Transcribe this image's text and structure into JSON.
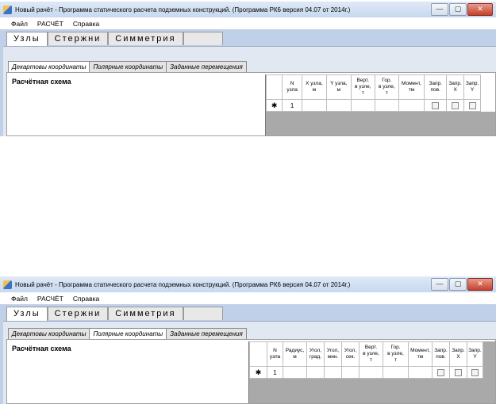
{
  "window": {
    "title_top": "Новый рачёт  -  Программа статического расчета подземных конструкций.  (Программа РК6 версия 04.07 от 2014г.)",
    "title_bottom": "Новый рачёт  -  Программа статического расчета подземных конструкций.  (Программа РК6 версия 04.07 от 2014г.)",
    "minimize": "—",
    "maximize": "▢",
    "close": "✕"
  },
  "menu": [
    "Файл",
    "РАСЧЁТ",
    "Справка"
  ],
  "main_tabs": [
    "Узлы",
    "Стержни",
    "Симметрия"
  ],
  "sub_tabs": [
    "Декартовы координаты",
    "Полярные координаты",
    "Заданные перемещения"
  ],
  "scheme_label": "Расчётная схема",
  "top_grid": {
    "columns": [
      "N\nузла",
      "X узла,\nм",
      "Y узла,\nм",
      "Верт.\nв узле,\nт",
      "Гор.\nв узле,\nт",
      "Момент,\nтм",
      "Запр.\nпов.",
      "Запр.\nX",
      "Запр.\nY"
    ],
    "row_marker": "✱",
    "row_value": "1"
  },
  "bottom_grid": {
    "columns": [
      "N\nузла",
      "Радиус,\nм",
      "Угол,\nград.",
      "Угол,\nмин.",
      "Угол,\nсек.",
      "Верт.\nв узле,\nт",
      "Гор.\nв узле,\nт",
      "Момент,\nтм",
      "Запр.\nпов.",
      "Запр.\nX",
      "Запр.\nY"
    ],
    "row_marker": "✱",
    "row_value": "1"
  },
  "colors": {
    "chrome": "#bfd0e8",
    "panel": "#e1e8f2",
    "grid_empty": "#a9a9a9"
  },
  "active_sub_tab": {
    "top": "Декартовы координаты",
    "bottom": "Полярные координаты"
  }
}
